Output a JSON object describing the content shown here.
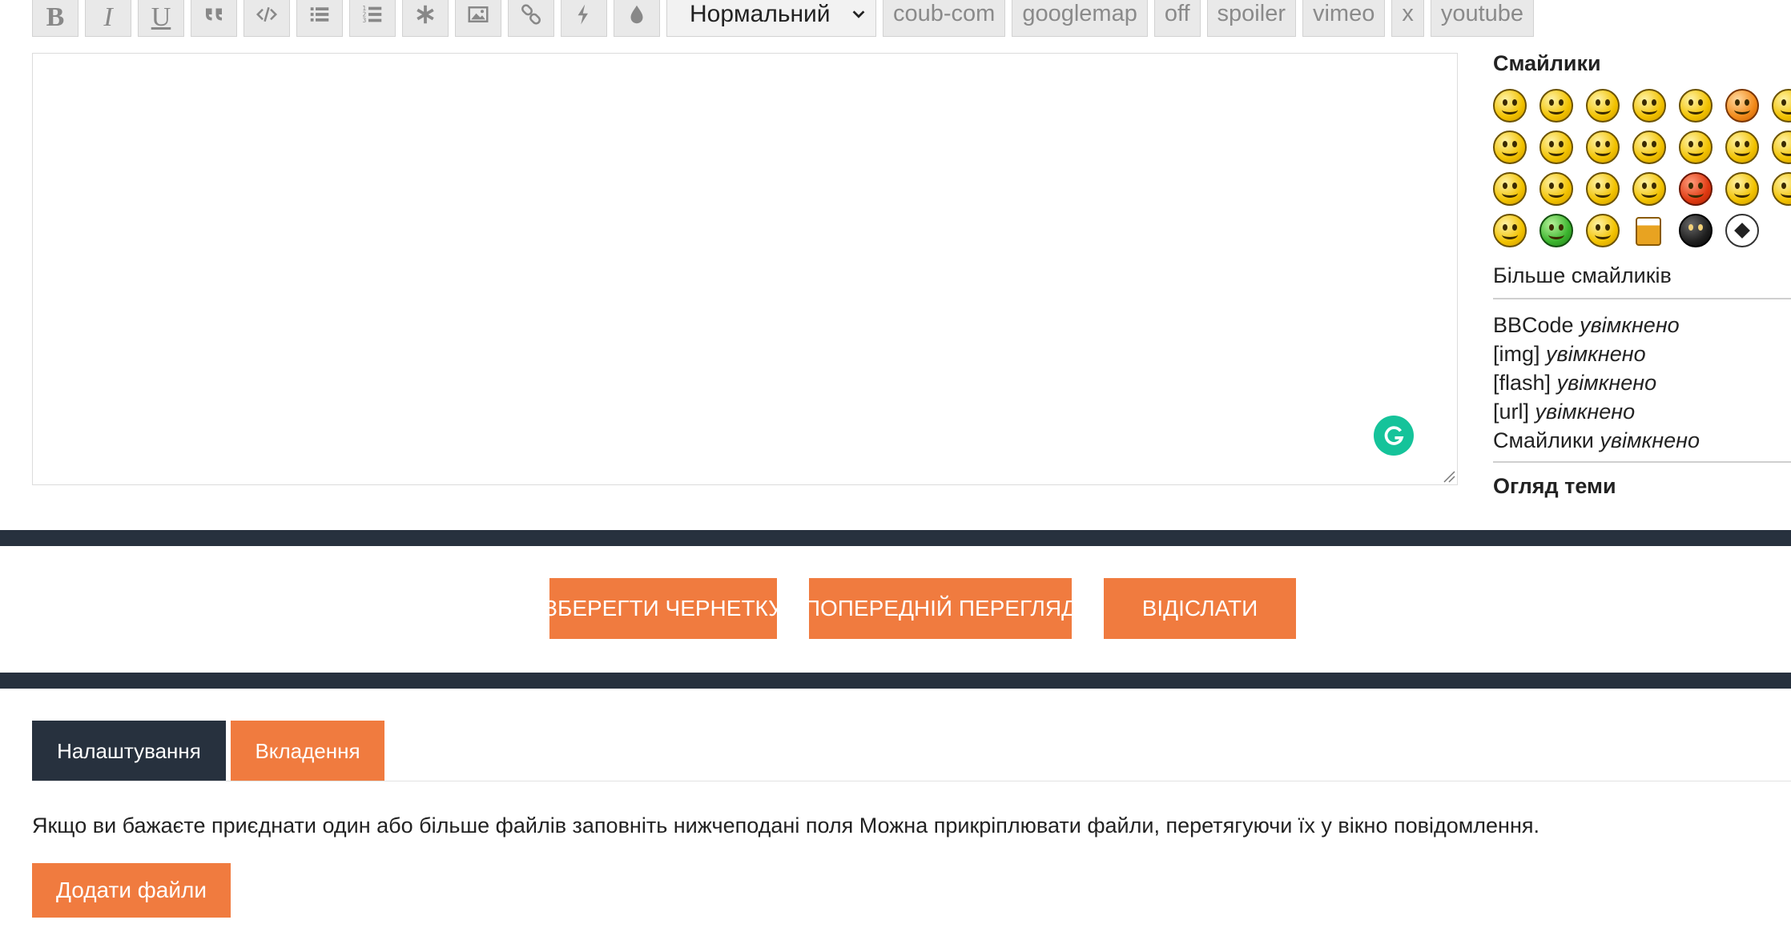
{
  "toolbar": {
    "icons": [
      {
        "name": "bold-icon",
        "glyph": "B"
      },
      {
        "name": "italic-icon",
        "glyph": "I"
      },
      {
        "name": "underline-icon",
        "glyph": "U"
      },
      {
        "name": "quote-icon"
      },
      {
        "name": "code-icon"
      },
      {
        "name": "bulleted-list-icon"
      },
      {
        "name": "numbered-list-icon"
      },
      {
        "name": "list-item-icon"
      },
      {
        "name": "image-icon"
      },
      {
        "name": "link-icon"
      },
      {
        "name": "flash-icon"
      },
      {
        "name": "color-icon"
      }
    ],
    "size_select": "Нормальний",
    "tags": [
      "coub-com",
      "googlemap",
      "off",
      "spoiler",
      "vimeo",
      "x",
      "youtube"
    ]
  },
  "editor": {
    "value": ""
  },
  "side": {
    "smileys_title": "Смайлики",
    "more_smileys": "Більше смайликів",
    "bbcode": [
      {
        "label": "BBCode",
        "state": "увімкнено"
      },
      {
        "label": "[img]",
        "state": "увімкнено"
      },
      {
        "label": "[flash]",
        "state": "увімкнено"
      },
      {
        "label": "[url]",
        "state": "увімкнено"
      },
      {
        "label": "Смайлики",
        "state": "увімкнено"
      }
    ],
    "topic_review": "Огляд теми"
  },
  "actions": {
    "save_draft": "ЗБЕРЕГТИ ЧЕРНЕТКУ",
    "preview": "ПОПЕРЕДНІЙ ПЕРЕГЛЯД",
    "submit": "ВІДІСЛАТИ"
  },
  "tabs": {
    "settings": "Налаштування",
    "attachments": "Вкладення"
  },
  "attachments": {
    "help": "Якщо ви бажаєте приєднати один або більше файлів заповніть нижчеподані поля Можна прикріплювати файли, перетягуючи їх у вікно повідомлення.",
    "add_files": "Додати файли"
  },
  "colors": {
    "accent": "#f07b3f",
    "dark": "#27313e",
    "grammarly": "#15c39a"
  }
}
